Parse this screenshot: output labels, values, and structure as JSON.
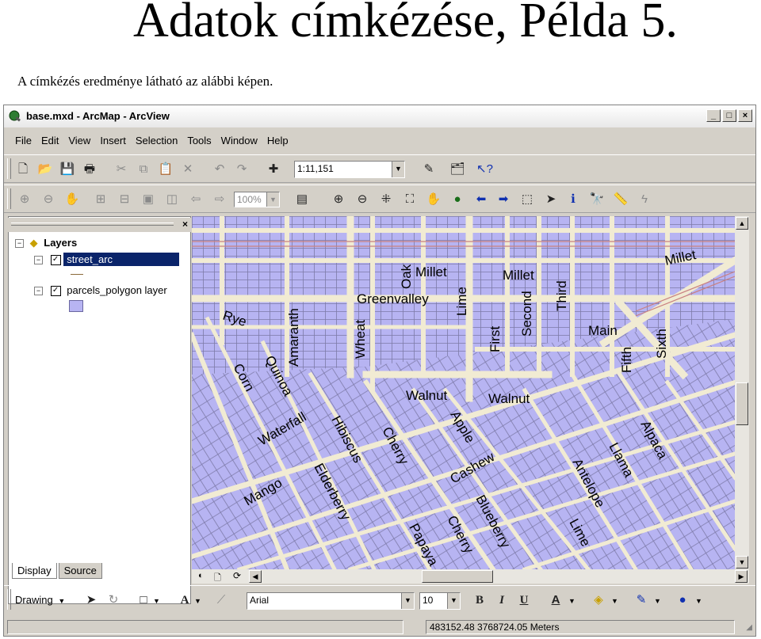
{
  "slide": {
    "title": "Adatok címkézése, Példa 5.",
    "subtitle": "A címkézés eredménye látható az alábbi képen."
  },
  "window": {
    "title": "base.mxd - ArcMap - ArcView",
    "buttons": {
      "minimize": "_",
      "maximize": "□",
      "close": "×"
    }
  },
  "menu": [
    "File",
    "Edit",
    "View",
    "Insert",
    "Selection",
    "Tools",
    "Window",
    "Help"
  ],
  "toolbar": {
    "scale": "1:11,151",
    "zoom_percent": "100%"
  },
  "toc": {
    "root": "Layers",
    "layers": [
      {
        "name": "street_arc",
        "checked": true,
        "selected": true
      },
      {
        "name": "parcels_polygon layer",
        "checked": true,
        "selected": false
      }
    ],
    "tabs": [
      "Display",
      "Source"
    ]
  },
  "map": {
    "colors": {
      "parcel": "#b7b4f2",
      "road": "#f1ebd3",
      "line": "#7d7aa8",
      "rail": "#c98080"
    },
    "labels": [
      "Millet",
      "Millet",
      "Millet",
      "Oak",
      "Greenvalley",
      "Lime",
      "Second",
      "Third",
      "Rye",
      "Amaranth",
      "Wheat",
      "First",
      "Main",
      "Fifth",
      "Sixth",
      "Corn",
      "Quinoa",
      "Walnut",
      "Walnut",
      "Waterfall",
      "Hibiscus",
      "Cherry",
      "Apple",
      "Cashew",
      "Alpaca",
      "Llama",
      "Antelope",
      "Mango",
      "Elderberry",
      "Blueberry",
      "Cherry",
      "Papaya",
      "Lime"
    ]
  },
  "drawing": {
    "menu_label": "Drawing",
    "font_name": "Arial",
    "font_size": "10",
    "bold": "B",
    "italic": "I",
    "underline": "U"
  },
  "status": {
    "coordinates": "483152.48  3768724.05 Meters"
  }
}
